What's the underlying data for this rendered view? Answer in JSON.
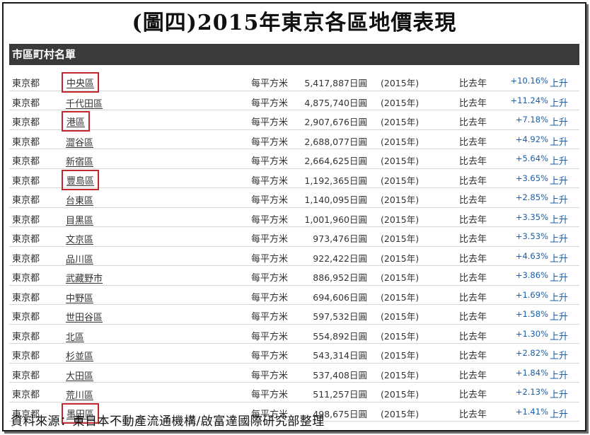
{
  "title": "(圖四)2015年東京各區地價表現",
  "header": "市區町村名單",
  "columns": {
    "unit": "每平方米",
    "compare": "比去年",
    "trend": "上升"
  },
  "rows": [
    {
      "pref": "東京都",
      "name": "中央區",
      "price": "5,417,887日圓",
      "year": "(2015年)",
      "pct": "+10.16%",
      "highlight": true
    },
    {
      "pref": "東京都",
      "name": "千代田區",
      "price": "4,875,740日圓",
      "year": "(2015年)",
      "pct": "+11.24%",
      "highlight": false
    },
    {
      "pref": "東京都",
      "name": "港區",
      "price": "2,907,676日圓",
      "year": "(2015年)",
      "pct": "+7.18%",
      "highlight": true
    },
    {
      "pref": "東京都",
      "name": "澀谷區",
      "price": "2,688,077日圓",
      "year": "(2015年)",
      "pct": "+4.92%",
      "highlight": false
    },
    {
      "pref": "東京都",
      "name": "新宿區",
      "price": "2,664,625日圓",
      "year": "(2015年)",
      "pct": "+5.64%",
      "highlight": false
    },
    {
      "pref": "東京都",
      "name": "豐島區",
      "price": "1,192,365日圓",
      "year": "(2015年)",
      "pct": "+3.65%",
      "highlight": true
    },
    {
      "pref": "東京都",
      "name": "台東區",
      "price": "1,140,095日圓",
      "year": "(2015年)",
      "pct": "+2.85%",
      "highlight": false
    },
    {
      "pref": "東京都",
      "name": "目黑區",
      "price": "1,001,960日圓",
      "year": "(2015年)",
      "pct": "+3.35%",
      "highlight": false
    },
    {
      "pref": "東京都",
      "name": "文京區",
      "price": "973,476日圓",
      "year": "(2015年)",
      "pct": "+3.53%",
      "highlight": false
    },
    {
      "pref": "東京都",
      "name": "品川區",
      "price": "922,422日圓",
      "year": "(2015年)",
      "pct": "+4.63%",
      "highlight": false
    },
    {
      "pref": "東京都",
      "name": "武藏野市",
      "price": "886,952日圓",
      "year": "(2015年)",
      "pct": "+3.86%",
      "highlight": false
    },
    {
      "pref": "東京都",
      "name": "中野區",
      "price": "694,606日圓",
      "year": "(2015年)",
      "pct": "+1.69%",
      "highlight": false
    },
    {
      "pref": "東京都",
      "name": "世田谷區",
      "price": "597,532日圓",
      "year": "(2015年)",
      "pct": "+1.58%",
      "highlight": false
    },
    {
      "pref": "東京都",
      "name": "北區",
      "price": "554,892日圓",
      "year": "(2015年)",
      "pct": "+1.30%",
      "highlight": false
    },
    {
      "pref": "東京都",
      "name": "杉並區",
      "price": "543,314日圓",
      "year": "(2015年)",
      "pct": "+2.82%",
      "highlight": false
    },
    {
      "pref": "東京都",
      "name": "大田區",
      "price": "537,408日圓",
      "year": "(2015年)",
      "pct": "+1.84%",
      "highlight": false
    },
    {
      "pref": "東京都",
      "name": "荒川區",
      "price": "511,257日圓",
      "year": "(2015年)",
      "pct": "+2.13%",
      "highlight": false
    },
    {
      "pref": "東京都",
      "name": "墨田區",
      "price": "498,675日圓",
      "year": "(2015年)",
      "pct": "+1.41%",
      "highlight": true
    }
  ],
  "source": "資料來源：東日本不動產流通機構/啟富達國際研究部整理",
  "colors": {
    "header_bg": "#3a3a3a",
    "highlight_border": "#c0282d",
    "link_blue": "#1a5fa8"
  }
}
